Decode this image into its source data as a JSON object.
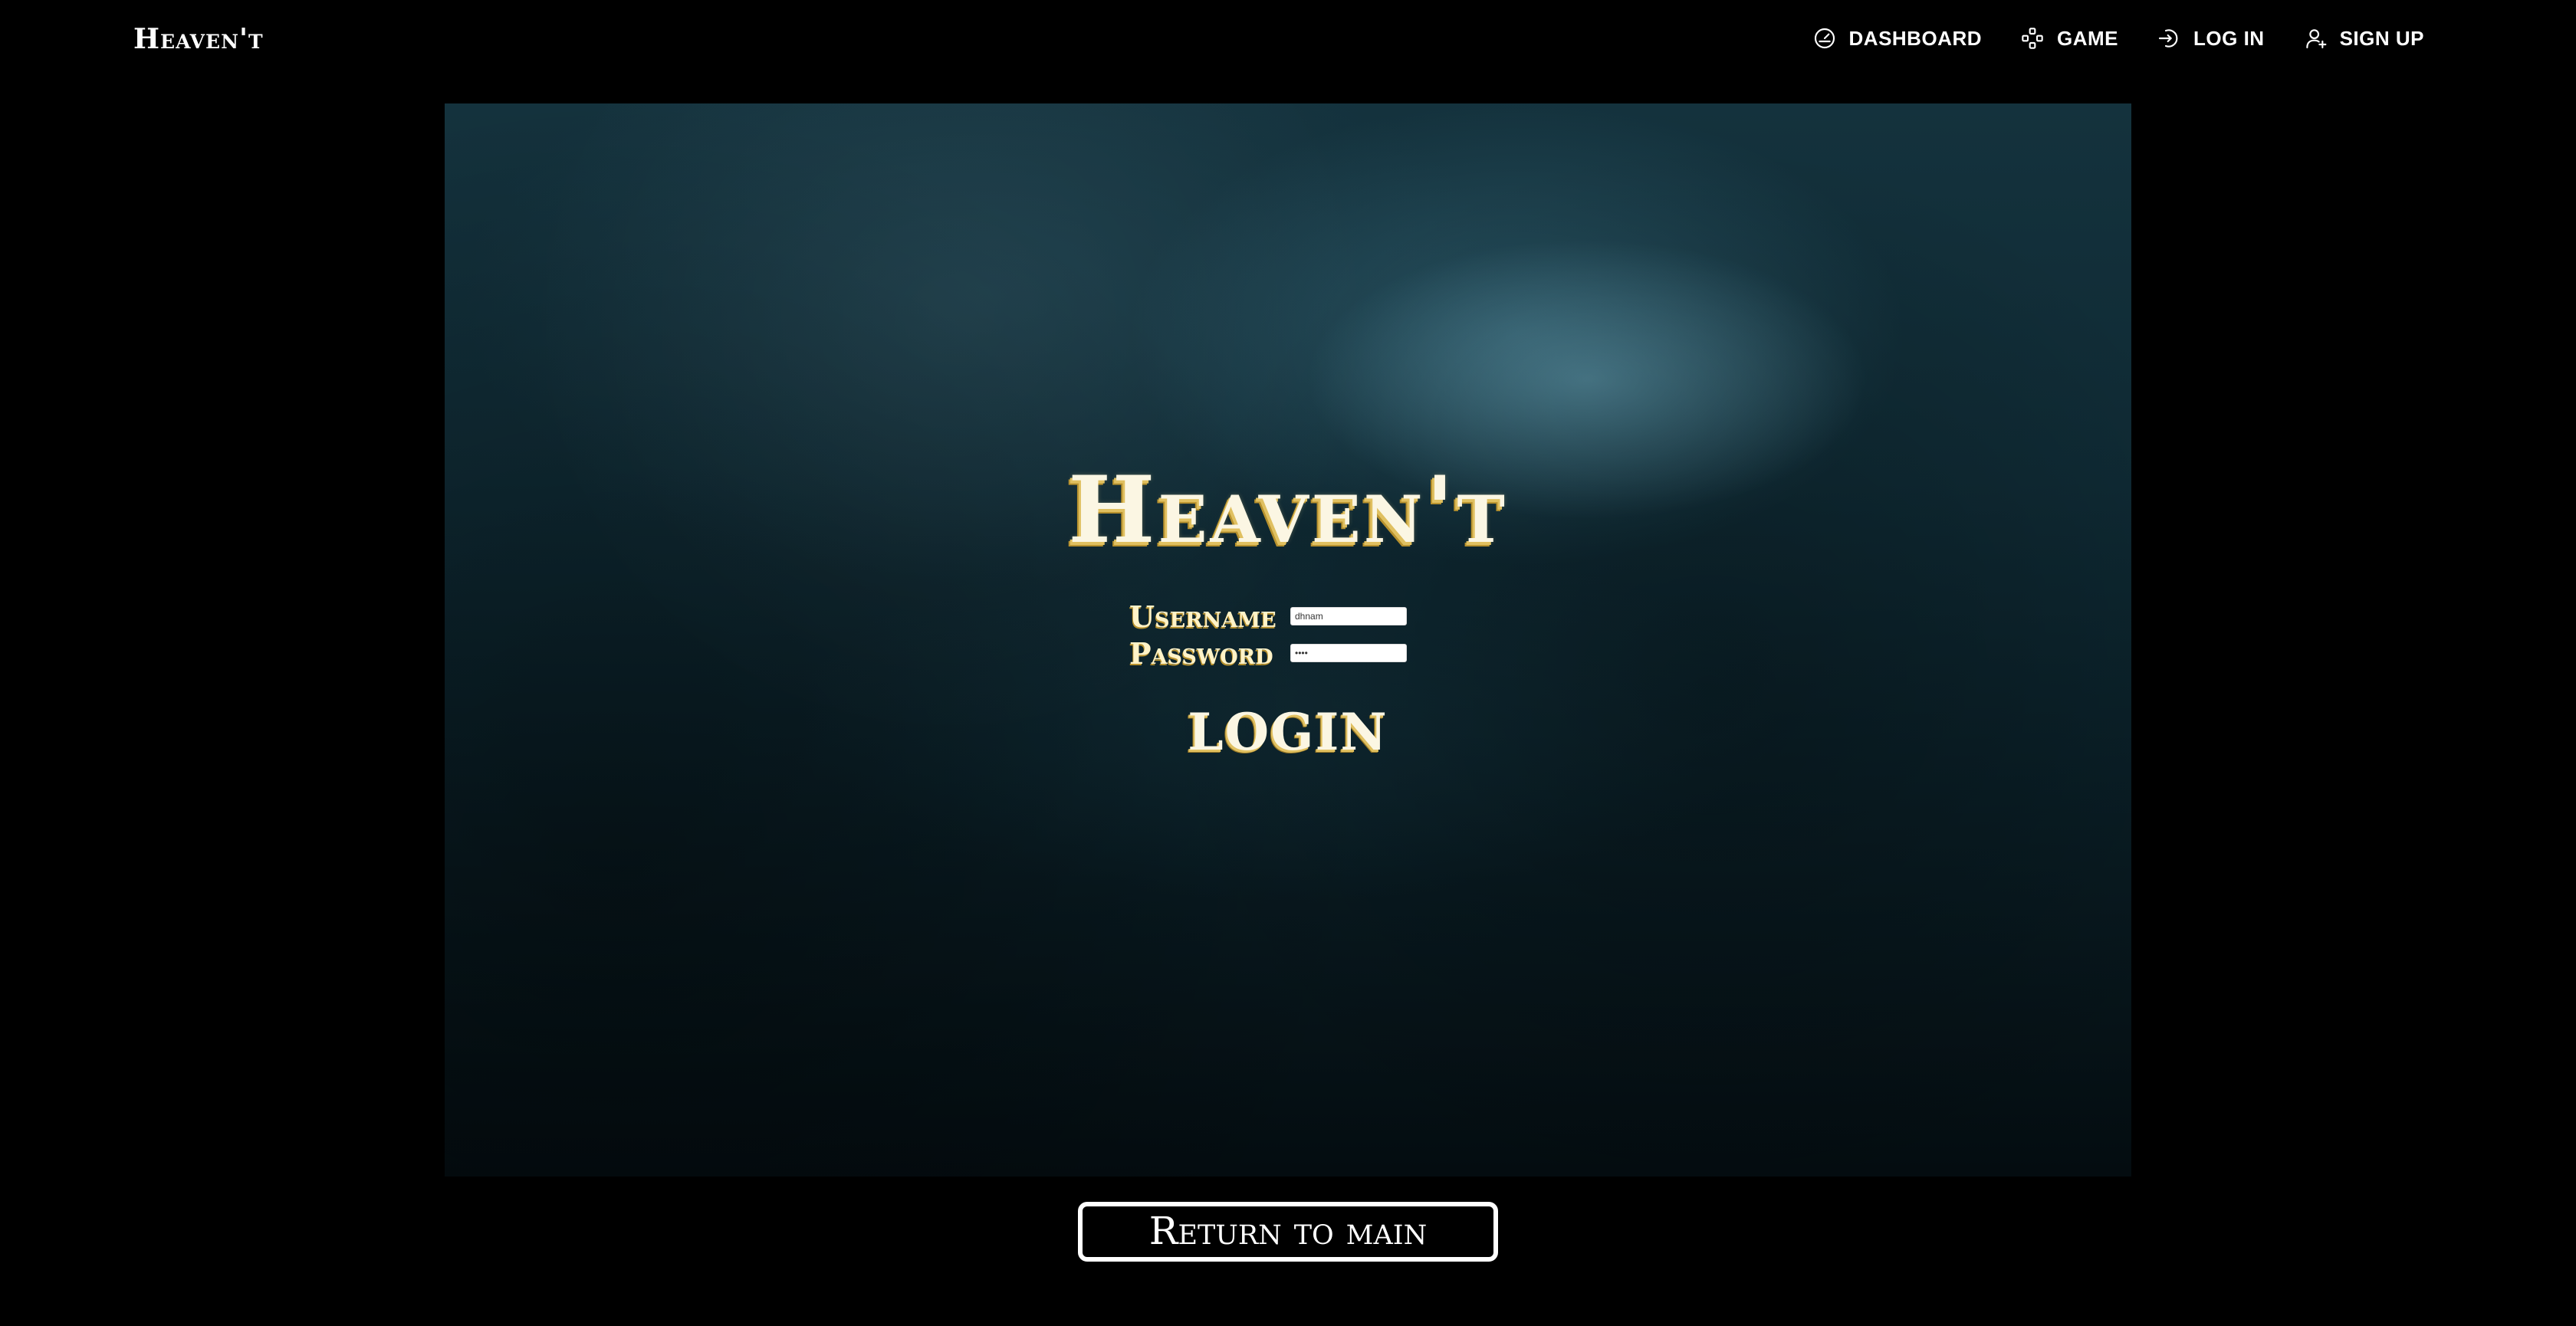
{
  "nav": {
    "brand": "Heaven't",
    "items": [
      {
        "label": "DASHBOARD",
        "icon": "gauge-icon"
      },
      {
        "label": "GAME",
        "icon": "gamepad-icon"
      },
      {
        "label": "LOG IN",
        "icon": "login-icon"
      },
      {
        "label": "SIGN UP",
        "icon": "user-add-icon"
      }
    ]
  },
  "login": {
    "title": "Heaven't",
    "username_label": "Username",
    "username_value": "dhnam",
    "password_label": "Password",
    "password_value": "••••",
    "submit_label": "LOGIN"
  },
  "footer": {
    "return_label": "Return to main"
  },
  "colors": {
    "background": "#000000",
    "title_gold": "#e0c060",
    "title_cream": "#fbf6e3"
  }
}
